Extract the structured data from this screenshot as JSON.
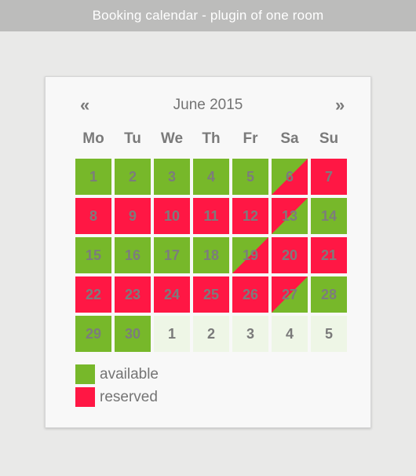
{
  "titlebar": {
    "title": "Booking calendar - plugin of one room"
  },
  "calendar": {
    "prev": "«",
    "next": "»",
    "month": "June 2015",
    "weekdays": [
      "Mo",
      "Tu",
      "We",
      "Th",
      "Fr",
      "Sa",
      "Su"
    ],
    "days": [
      {
        "label": "1",
        "status": "available"
      },
      {
        "label": "2",
        "status": "available"
      },
      {
        "label": "3",
        "status": "available"
      },
      {
        "label": "4",
        "status": "available"
      },
      {
        "label": "5",
        "status": "available"
      },
      {
        "label": "6",
        "status": "available-reserved"
      },
      {
        "label": "7",
        "status": "reserved"
      },
      {
        "label": "8",
        "status": "reserved"
      },
      {
        "label": "9",
        "status": "reserved"
      },
      {
        "label": "10",
        "status": "reserved"
      },
      {
        "label": "11",
        "status": "reserved"
      },
      {
        "label": "12",
        "status": "reserved"
      },
      {
        "label": "13",
        "status": "reserved-available"
      },
      {
        "label": "14",
        "status": "available"
      },
      {
        "label": "15",
        "status": "available"
      },
      {
        "label": "16",
        "status": "available"
      },
      {
        "label": "17",
        "status": "available"
      },
      {
        "label": "18",
        "status": "available"
      },
      {
        "label": "19",
        "status": "available-reserved"
      },
      {
        "label": "20",
        "status": "reserved"
      },
      {
        "label": "21",
        "status": "reserved"
      },
      {
        "label": "22",
        "status": "reserved"
      },
      {
        "label": "23",
        "status": "reserved"
      },
      {
        "label": "24",
        "status": "reserved"
      },
      {
        "label": "25",
        "status": "reserved"
      },
      {
        "label": "26",
        "status": "reserved"
      },
      {
        "label": "27",
        "status": "reserved-available"
      },
      {
        "label": "28",
        "status": "available"
      },
      {
        "label": "29",
        "status": "available"
      },
      {
        "label": "30",
        "status": "available"
      },
      {
        "label": "1",
        "status": "other"
      },
      {
        "label": "2",
        "status": "other"
      },
      {
        "label": "3",
        "status": "other"
      },
      {
        "label": "4",
        "status": "other"
      },
      {
        "label": "5",
        "status": "other"
      }
    ]
  },
  "legend": {
    "available": "available",
    "reserved": "reserved"
  },
  "colors": {
    "available": "#77b82a",
    "reserved": "#ff1744",
    "other_month": "#eef6e6"
  }
}
